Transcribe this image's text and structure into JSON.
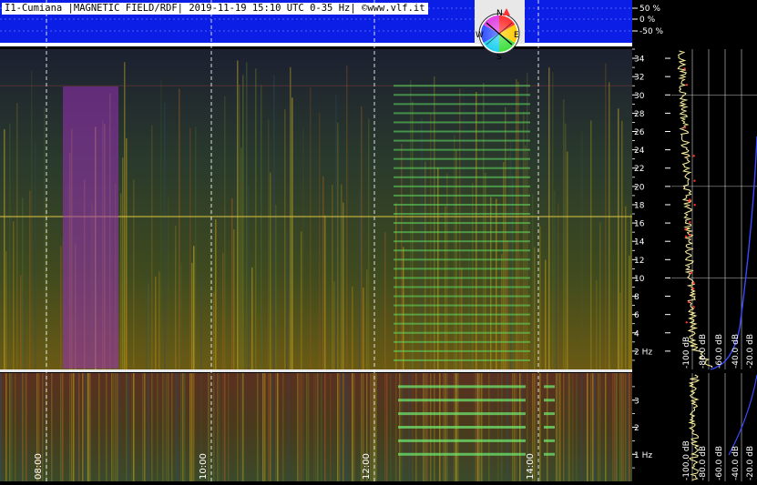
{
  "header": {
    "station": "I1-Cumiana",
    "mode": "MAGNETIC FIELD/RDF",
    "timestamp": "2019-11-19 15:10 UTC",
    "range": "0-35 Hz",
    "site": "©www.vlf.it"
  },
  "compass": {
    "north": "N",
    "east": "E",
    "south": "S",
    "west": "W"
  },
  "rdf_scale": [
    "50 %",
    "0 %",
    "-50 %"
  ],
  "colors": {
    "rdf_band": "#0a1ee6",
    "spectro_base": "#1a1a3a",
    "spectrum_trace": "#fff4a0",
    "spectrum_peak": "#ff3030",
    "grid": "#ffffff",
    "purple_block": "#9b2fb8"
  },
  "chart_data": {
    "type": "heatmap",
    "title": "I1-Cumiana |MAGNETIC FIELD/RDF| 2019-11-19 15:10 UTC 0-35 Hz| ©www.vlf.it",
    "x_time_ticks": [
      "08:00",
      "10:00",
      "12:00",
      "14:00"
    ],
    "upper_panel": {
      "ylabel_unit": "Hz",
      "ylim": [
        0,
        35
      ],
      "y_ticks": [
        34,
        32,
        30,
        28,
        26,
        24,
        22,
        20,
        18,
        16,
        14,
        12,
        10,
        8,
        6,
        4,
        2
      ],
      "y_tick_labels": [
        "34",
        "32",
        "30",
        "28",
        "26",
        "24",
        "22",
        "20",
        "18",
        "16",
        "14",
        "12",
        "10",
        "8",
        "6",
        "4",
        "2 Hz"
      ]
    },
    "lower_panel": {
      "ylabel_unit": "Hz",
      "ylim": [
        0,
        4
      ],
      "y_ticks": [
        3,
        2,
        1
      ],
      "y_tick_labels": [
        "3",
        "2",
        "1 Hz"
      ]
    },
    "spectrum_db_labels": [
      "-100 dB",
      "-80.0 dB",
      "-60.0 dB",
      "-40.0 dB",
      "-20.0 dB"
    ],
    "spectrum_db_labels_lower": [
      "-100.0 dB",
      "-80.0 dB",
      "-60.0 dB",
      "-40.0 dB",
      "-20.0 dB"
    ]
  }
}
